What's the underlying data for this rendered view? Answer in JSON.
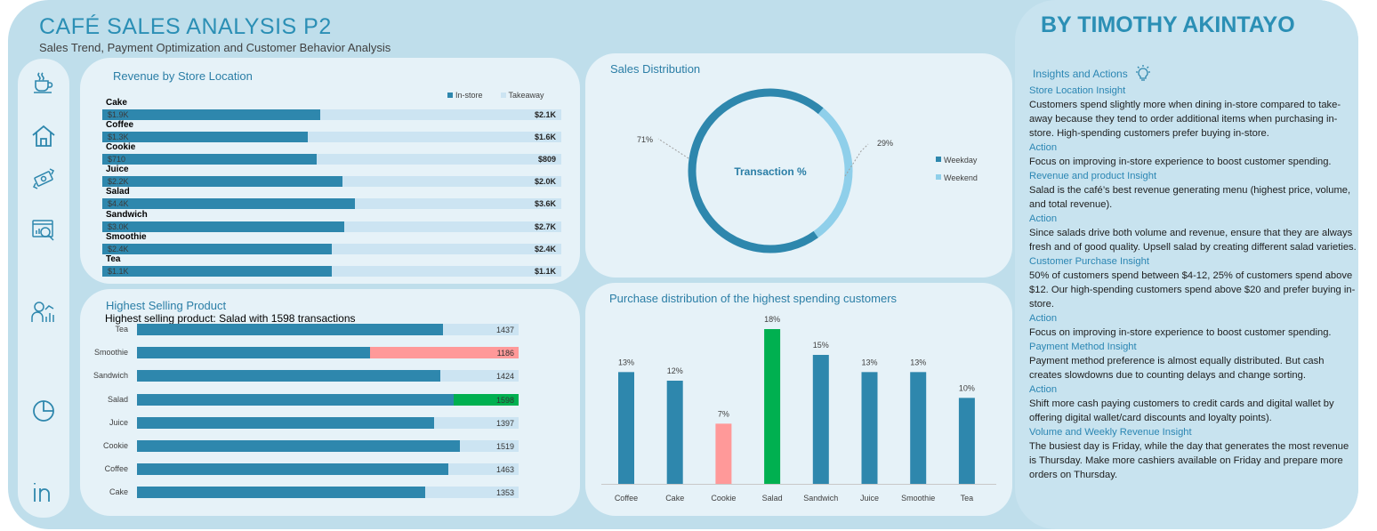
{
  "header": {
    "title": "CAFÉ SALES ANALYSIS P2",
    "subtitle": "Sales Trend, Payment Optimization and Customer Behavior Analysis",
    "author": "BY TIMOTHY AKINTAYO"
  },
  "sidebar": {
    "icons": [
      "coffee-cup-icon",
      "home-icon",
      "money-exchange-icon",
      "analytics-report-icon",
      "customer-chart-icon",
      "pie-chart-icon",
      "linkedin-icon"
    ]
  },
  "colors": {
    "primary": "#2e87ad",
    "light": "#cce4f2",
    "highlight_green": "#00b050",
    "highlight_pink": "#ff9999",
    "weekend": "#8fcfea",
    "title": "#2b8fb5"
  },
  "revenue_by_store": {
    "title": "Revenue by Store Location",
    "legend": [
      "In-store",
      "Takeaway"
    ]
  },
  "sales_distribution": {
    "title": "Sales Distribution",
    "center_label": "Transaction %",
    "legend": [
      "Weekday",
      "Weekend"
    ]
  },
  "highest_selling": {
    "title": "Highest Selling Product",
    "note": "Highest selling product: Salad with 1598 transactions"
  },
  "purchase_distribution": {
    "title": "Purchase distribution of the highest spending customers"
  },
  "chart_data": [
    {
      "type": "bar",
      "title": "Revenue by Store Location",
      "orientation": "horizontal",
      "categories": [
        "Cake",
        "Coffee",
        "Cookie",
        "Juice",
        "Salad",
        "Sandwich",
        "Smoothie",
        "Tea"
      ],
      "series": [
        {
          "name": "In-store",
          "values": [
            1900,
            1300,
            710,
            2200,
            4400,
            3000,
            2400,
            1100
          ],
          "labels": [
            "$1.9K",
            "$1.3K",
            "$710",
            "$2.2K",
            "$4.4K",
            "$3.0K",
            "$2.4K",
            "$1.1K"
          ]
        },
        {
          "name": "Takeaway",
          "values": [
            2100,
            1600,
            809,
            2000,
            3600,
            2700,
            2400,
            1100
          ],
          "labels": [
            "$2.1K",
            "$1.6K",
            "$809",
            "$2.0K",
            "$3.6K",
            "$2.7K",
            "$2.4K",
            "$1.1K"
          ]
        }
      ],
      "legend": "top-right"
    },
    {
      "type": "pie",
      "title": "Sales Distribution",
      "categories": [
        "Weekday",
        "Weekend"
      ],
      "values": [
        71,
        29
      ],
      "labels": [
        "71%",
        "29%"
      ],
      "legend": "right"
    },
    {
      "type": "bar",
      "title": "Highest Selling Product",
      "orientation": "horizontal",
      "categories": [
        "Tea",
        "Smoothie",
        "Sandwich",
        "Salad",
        "Juice",
        "Cookie",
        "Coffee",
        "Cake"
      ],
      "values": [
        1437,
        1186,
        1424,
        1598,
        1397,
        1519,
        1463,
        1353
      ],
      "highlight": {
        "Salad": "#00b050",
        "Smoothie": "#ff9999"
      }
    },
    {
      "type": "bar",
      "title": "Purchase distribution of the highest spending customers",
      "categories": [
        "Coffee",
        "Cake",
        "Cookie",
        "Salad",
        "Sandwich",
        "Juice",
        "Smoothie",
        "Tea"
      ],
      "values": [
        13,
        12,
        7,
        18,
        15,
        13,
        13,
        10
      ],
      "labels": [
        "13%",
        "12%",
        "7%",
        "18%",
        "15%",
        "13%",
        "13%",
        "10%"
      ],
      "highlight": {
        "Salad": "#00b050",
        "Cookie": "#ff9999"
      }
    }
  ],
  "insights": {
    "title": "Insights and Actions",
    "sections": [
      {
        "heading": "Store Location Insight",
        "text": "Customers spend slightly more when dining in-store compared to take-away because they tend to order additional items when purchasing in-store. High-spending customers prefer buying in-store."
      },
      {
        "heading": "Action",
        "text": "Focus on improving in-store experience to boost customer spending."
      },
      {
        "heading": "Revenue and product Insight",
        "text": "Salad is the café’s best revenue generating menu (highest price, volume, and total revenue)."
      },
      {
        "heading": "Action",
        "text": "Since salads drive both volume and revenue, ensure that they are always fresh and of good quality. Upsell salad by creating different salad varieties."
      },
      {
        "heading": "Customer Purchase Insight",
        "text": "50% of customers spend between $4-12, 25% of customers spend above $12. Our high-spending customers spend above $20 and prefer buying in-store."
      },
      {
        "heading": "Action",
        "text": "Focus on improving in-store experience to boost customer spending."
      },
      {
        "heading": "Payment Method Insight",
        "text": "Payment method preference is almost equally distributed. But cash creates slowdowns due to counting delays and change sorting."
      },
      {
        "heading": "Action",
        "text": "Shift more cash paying customers to credit cards and digital wallet by offering digital wallet/card discounts and loyalty points)."
      },
      {
        "heading": "Volume and Weekly Revenue Insight",
        "text": "The busiest day is Friday, while the day that generates the most revenue is Thursday. Make more cashiers available on Friday and prepare more orders on Thursday."
      }
    ]
  }
}
